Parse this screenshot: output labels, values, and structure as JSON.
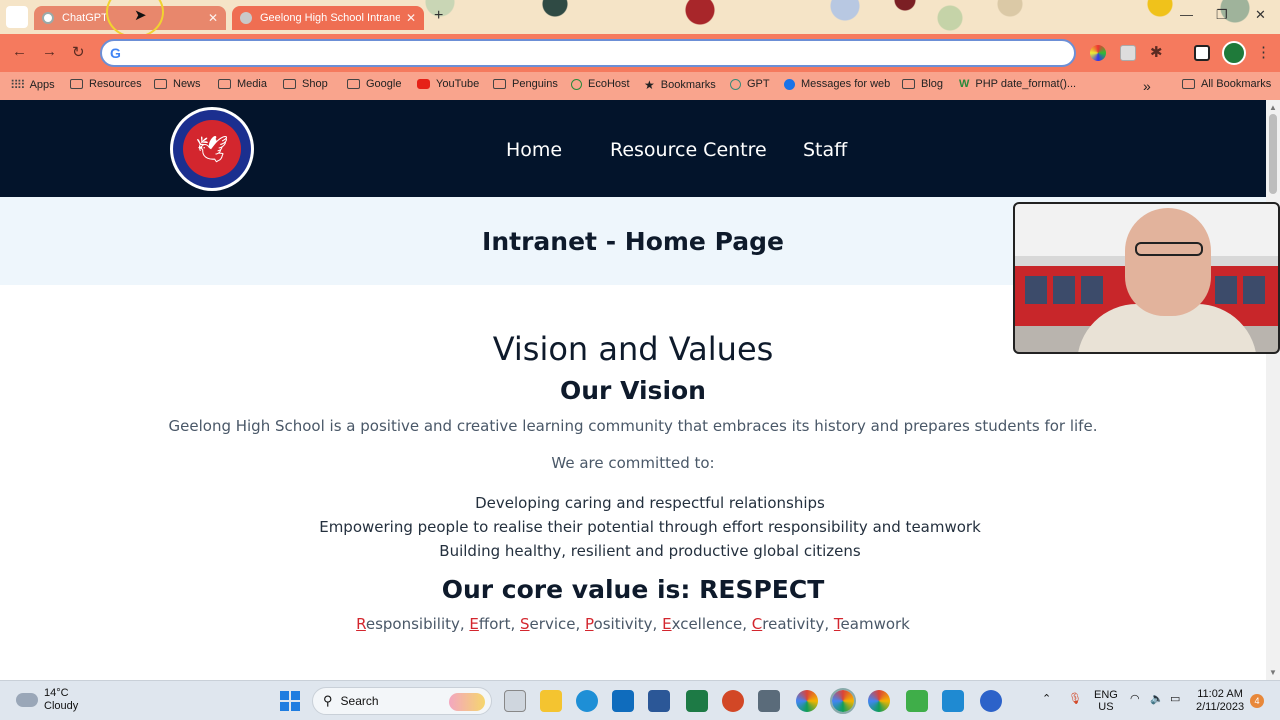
{
  "browser": {
    "tabs": [
      {
        "title": "ChatGPT",
        "active": false
      },
      {
        "title": "Geelong High School Intranet",
        "active": true
      }
    ],
    "address_value": "",
    "bookmarks": [
      {
        "label": "Apps",
        "icon": "apps-grid-icon"
      },
      {
        "label": "Resources",
        "icon": "folder-icon"
      },
      {
        "label": "News",
        "icon": "folder-icon"
      },
      {
        "label": "Media",
        "icon": "folder-icon"
      },
      {
        "label": "Shop",
        "icon": "folder-icon"
      },
      {
        "label": "Google",
        "icon": "folder-icon"
      },
      {
        "label": "YouTube",
        "icon": "youtube-icon"
      },
      {
        "label": "Penguins",
        "icon": "folder-icon"
      },
      {
        "label": "EcoHost",
        "icon": "ecohost-icon"
      },
      {
        "label": "Bookmarks",
        "icon": "star-icon"
      },
      {
        "label": "GPT",
        "icon": "gpt-icon"
      },
      {
        "label": "Messages for web",
        "icon": "messages-icon"
      },
      {
        "label": "Blog",
        "icon": "folder-icon"
      },
      {
        "label": "PHP date_format()...",
        "icon": "php-icon"
      }
    ],
    "all_bookmarks": "All Bookmarks"
  },
  "site": {
    "nav": [
      "Home",
      "Resource Centre",
      "Staff"
    ],
    "page_title": "Intranet - Home Page",
    "heading": "Vision and Values",
    "vision_heading": "Our Vision",
    "vision_text": "Geelong High School is a positive and creative learning community that embraces its history and prepares students for life.",
    "committed": "We are committed to:",
    "commitments": [
      "Developing caring and respectful relationships",
      "Empowering people to realise their potential through effort responsibility and teamwork",
      "Building healthy, resilient and productive global citizens"
    ],
    "core_heading": "Our core value is: RESPECT",
    "values": [
      {
        "first": "R",
        "rest": "esponsibility"
      },
      {
        "first": "E",
        "rest": "ffort"
      },
      {
        "first": "S",
        "rest": "ervice"
      },
      {
        "first": "P",
        "rest": "ositivity"
      },
      {
        "first": "E",
        "rest": "xcellence"
      },
      {
        "first": "C",
        "rest": "reativity"
      },
      {
        "first": "T",
        "rest": "eamwork"
      }
    ]
  },
  "taskbar": {
    "temp": "14°C",
    "weather": "Cloudy",
    "search_placeholder": "Search",
    "lang1": "ENG",
    "lang2": "US",
    "time": "11:02 AM",
    "date": "2/11/2023",
    "notifications": "4"
  },
  "colors": {
    "header": "#03142b",
    "band": "#eef6fc",
    "accent_red": "#d3262e",
    "tab_active": "#ef6e52",
    "toolbar": "#f57a5e",
    "bookmarks_bar": "#f9a48d"
  }
}
